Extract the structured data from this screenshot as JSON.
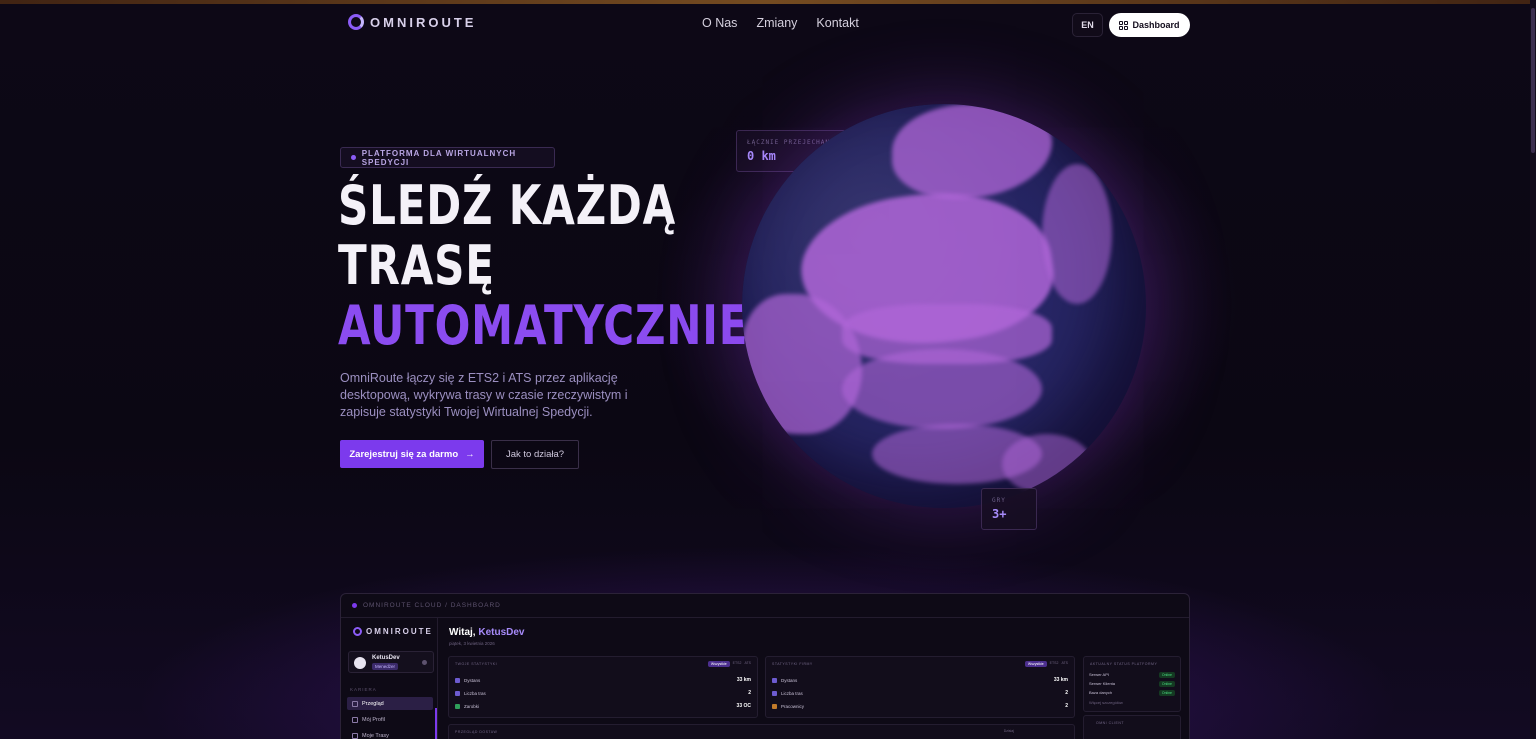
{
  "nav": {
    "logo_text": "OMNIROUTE",
    "links": [
      "O Nas",
      "Zmiany",
      "Kontakt"
    ],
    "lang_label": "EN",
    "dashboard_label": "Dashboard"
  },
  "hero": {
    "badge": "PLATFORMA DLA WIRTUALNYCH SPEDYCJI",
    "headline_line1": "ŚLEDŹ KAŻDĄ",
    "headline_line2": "TRASĘ",
    "headline_accent": "AUTOMATYCZNIE",
    "lead": "OmniRoute łączy się z ETS2 i ATS przez aplikację desktopową, wykrywa trasy w czasie rzeczywistym i zapisuje statystyki Twojej Wirtualnej Spedycji.",
    "cta_primary": "Zarejestruj się za darmo",
    "cta_primary_arrow": "→",
    "cta_secondary": "Jak to działa?"
  },
  "globe": {
    "stat_top_label": "ŁĄCZNIE PRZEJECHANO",
    "stat_top_value": "0 km",
    "stat_bottom_label": "GRY",
    "stat_bottom_value": "3+"
  },
  "preview": {
    "bar_title": "OMNIROUTE CLOUD / DASHBOARD",
    "sidebar": {
      "logo_text": "OMNIROUTE",
      "user_name": "KetusDev",
      "user_role": "Menedżer",
      "section_label": "KARIERA",
      "items": [
        "Przegląd",
        "Mój Profil",
        "Moje Trasy"
      ]
    },
    "greeting_prefix": "Witaj,",
    "greeting_name": "KetusDev",
    "date": "piątek, 3 kwietnia 2026",
    "card_personal": {
      "title": "TWOJE STATYSTYKI",
      "tabs": [
        "Wszystkie",
        "ETS2",
        "ATS"
      ],
      "rows": [
        {
          "label": "Dystans",
          "value": "33 km"
        },
        {
          "label": "Liczba tras",
          "value": "2"
        },
        {
          "label": "Zarobki",
          "value": "33 OC"
        }
      ]
    },
    "card_company": {
      "title": "STATYSTYKI FIRMY",
      "tabs": [
        "Wszystkie",
        "ETS2",
        "ATS"
      ],
      "rows": [
        {
          "label": "Dystans",
          "value": "33 km"
        },
        {
          "label": "Liczba tras",
          "value": "2"
        },
        {
          "label": "Pracownicy",
          "value": "2"
        }
      ]
    },
    "card_status": {
      "title": "AKTUALNY STATUS PLATFORMY",
      "rows": [
        {
          "label": "Serwer API",
          "status": "Online"
        },
        {
          "label": "Serwer Klienta",
          "status": "Online"
        },
        {
          "label": "Baza danych",
          "status": "Online"
        }
      ],
      "more": "Więcej szczegółów"
    },
    "card_client": {
      "title": "OMNI CLIENT"
    },
    "card_recent": {
      "title": "PRZEGLĄD DOSTAW",
      "filter": "Dzisiaj"
    }
  },
  "colors": {
    "accent": "#7c3aed",
    "accent_text": "#8b4cf0",
    "background": "#0b0713"
  }
}
